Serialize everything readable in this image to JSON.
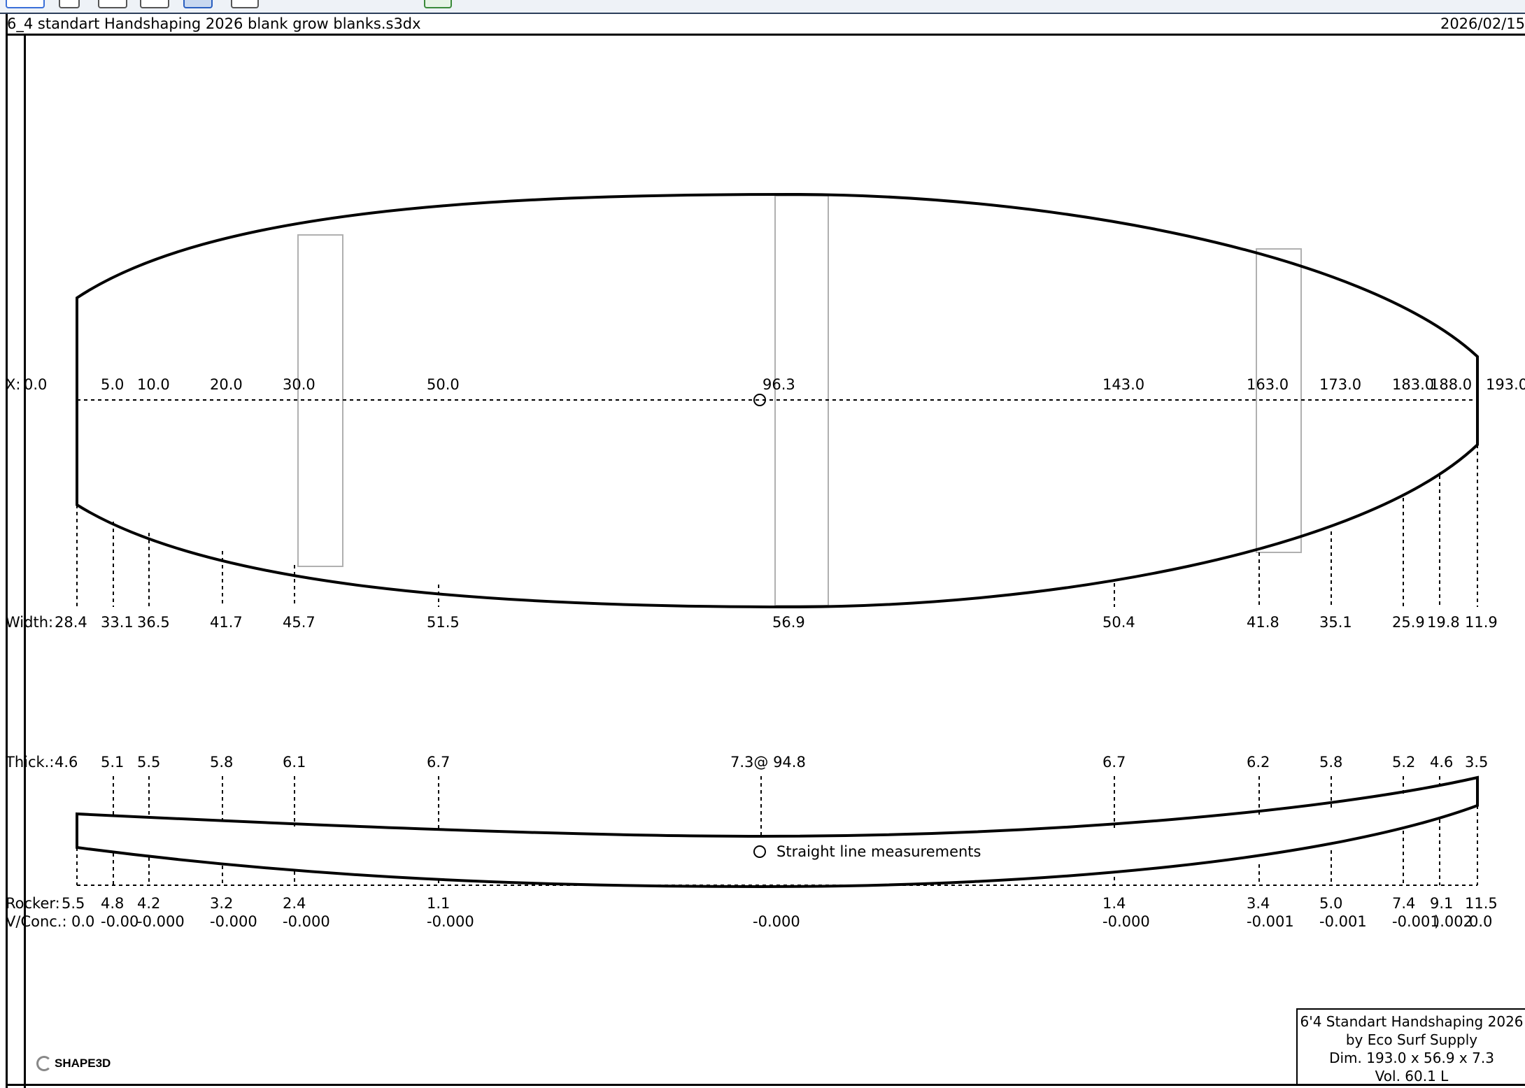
{
  "window": {
    "file_name": "6_4 standart Handshaping 2026 blank grow blanks.s3dx",
    "date": "2026/02/15"
  },
  "toolbar": {
    "icons": [
      "outline-view-icon",
      "rocker-view-icon",
      "slice-view-icon",
      "3d-view-icon",
      "color-view-icon",
      "curve-tool-icon",
      "green-square-icon"
    ]
  },
  "outline": {
    "x_prefix": "X:",
    "x_labels": [
      "0.0",
      "5.0",
      "10.0",
      "20.0",
      "30.0",
      "50.0",
      "96.3",
      "143.0",
      "163.0",
      "173.0",
      "183.0",
      "188.0",
      "193.0"
    ],
    "width_prefix": "Width:",
    "width_labels": [
      "28.4",
      "33.1",
      "36.5",
      "41.7",
      "45.7",
      "51.5",
      "56.9",
      "50.4",
      "41.8",
      "35.1",
      "25.9",
      "19.8",
      "11.9"
    ]
  },
  "profile": {
    "thick_prefix": "Thick.:",
    "thick_labels": [
      "4.6",
      "5.1",
      "5.5",
      "5.8",
      "6.1",
      "6.7",
      "7.3@ 94.8",
      "6.7",
      "6.2",
      "5.8",
      "5.2",
      "4.6",
      "3.5"
    ],
    "legend_label": "Straight line measurements",
    "rocker_prefix": "Rocker:",
    "rocker_labels": [
      "5.5",
      "4.8",
      "4.2",
      "3.2",
      "2.4",
      "1.1",
      "1.4",
      "3.4",
      "5.0",
      "7.4",
      "9.1",
      "11.5"
    ],
    "conc_prefix": "V/Conc.:",
    "conc_labels": [
      "0.0",
      "-0.00",
      "-0.000",
      "-0.000",
      "-0.000",
      "-0.000",
      "-0.000",
      "-0.000",
      "-0.001",
      "-0.001",
      "-0.001",
      ").002",
      "0.0"
    ]
  },
  "info": {
    "line1": "6'4 Standart Handshaping 2026",
    "line2": "by Eco Surf Supply",
    "line3": "Dim. 193.0 x 56.9 x 7.3",
    "line4": "Vol. 60.1 L"
  },
  "logo": {
    "text": "SHAPE3D"
  }
}
